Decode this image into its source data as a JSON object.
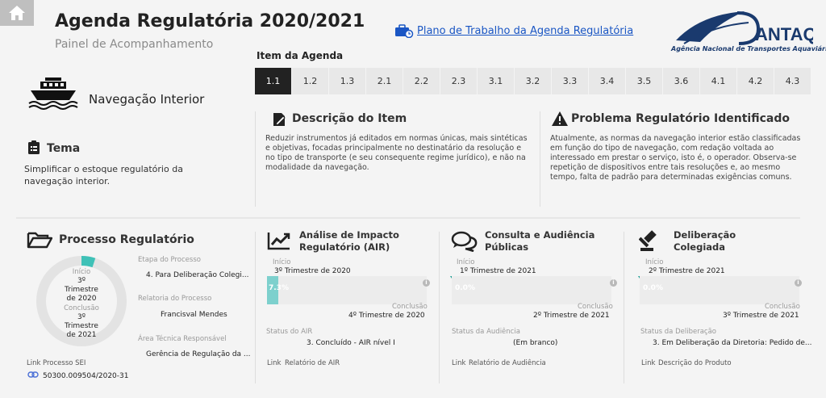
{
  "header": {
    "title": "Agenda Regulatória 2020/2021",
    "subtitle": "Painel de Acompanhamento",
    "plan_link": "Plano de Trabalho da Agenda Regulatória",
    "logo_text": "ANTAQ",
    "logo_sub": "Agência Nacional de Transportes Aquaviários"
  },
  "agenda": {
    "label": "Item da Agenda",
    "items": [
      "1.1",
      "1.2",
      "1.3",
      "2.1",
      "2.2",
      "2.3",
      "3.1",
      "3.2",
      "3.3",
      "3.4",
      "3.5",
      "3.6",
      "4.1",
      "4.2",
      "4.3"
    ],
    "selected": "1.1"
  },
  "theme_area": {
    "area_title": "Navegação Interior",
    "tema_label": "Tema",
    "tema_text": "Simplificar o estoque regulatório da navegação interior."
  },
  "descricao": {
    "label": "Descrição do Item",
    "text": "Reduzir instrumentos já editados em normas únicas, mais sintéticas e objetivas, focadas principalmente no destinatário da resolução e no tipo de transporte (e seu consequente regime jurídico), e não na modalidade da navegação."
  },
  "problema": {
    "label": "Problema Regulatório Identificado",
    "text": "Atualmente, as normas da navegação interior estão classificadas em função do tipo de navegação, com redação voltada ao interessado em prestar o serviço, isto é, o operador. Observa-se repetição de dispositivos entre tais resoluções e, ao mesmo tempo, falta de padrão para determinadas exigências comuns."
  },
  "processo": {
    "label": "Processo Regulatório",
    "inicio_label": "Início",
    "inicio_value": "3º Trimestre de 2020",
    "conclusao_label": "Conclusão",
    "conclusao_value": "3º Trimestre de 2021",
    "progress_fraction": 0.05,
    "etapa_label": "Etapa do Processo",
    "etapa_value": "4. Para Deliberação Colegi...",
    "relatoria_label": "Relatoria do Processo",
    "relatoria_value": "Francisval Mendes",
    "area_label": "Área Técnica Responsável",
    "area_value": "Gerência de Regulação da ...",
    "link_label": "Link",
    "link_title": "Processo SEI",
    "link_value": "50300.009504/2020-31"
  },
  "cards": [
    {
      "title": "Análise de Impacto Regulatório (AIR)",
      "inicio_label": "Início",
      "inicio_value": "3º Trimestre de 2020",
      "progress_pct": 7.3,
      "progress_text": "7.3%",
      "conclusao_label": "Conclusão",
      "conclusao_value": "4º Trimestre de 2020",
      "status_label": "Status do AIR",
      "status_value": "3. Concluído - AIR nível I",
      "link_label": "Link",
      "link_value": "Relatório de AIR"
    },
    {
      "title": "Consulta e Audiência Públicas",
      "inicio_label": "Início",
      "inicio_value": "1º Trimestre de 2021",
      "progress_pct": 0,
      "progress_text": "0.0%",
      "conclusao_label": "Conclusão",
      "conclusao_value": "2º Trimestre de 2021",
      "status_label": "Status da Audiência",
      "status_value": "(Em branco)",
      "link_label": "Link",
      "link_value": "Relatório de Audiência"
    },
    {
      "title": "Deliberação Colegiada",
      "inicio_label": "Início",
      "inicio_value": "2º Trimestre de 2021",
      "progress_pct": 0,
      "progress_text": "0.0%",
      "conclusao_label": "Conclusão",
      "conclusao_value": "3º Trimestre de 2021",
      "status_label": "Status da Deliberação",
      "status_value": "3. Em Deliberação da Diretoria: Pedido de...",
      "link_label": "Link",
      "link_value": "Descrição do Produto"
    }
  ],
  "colors": {
    "accent": "#3fc1b7",
    "link": "#1a56c4",
    "active_tab": "#222222"
  }
}
